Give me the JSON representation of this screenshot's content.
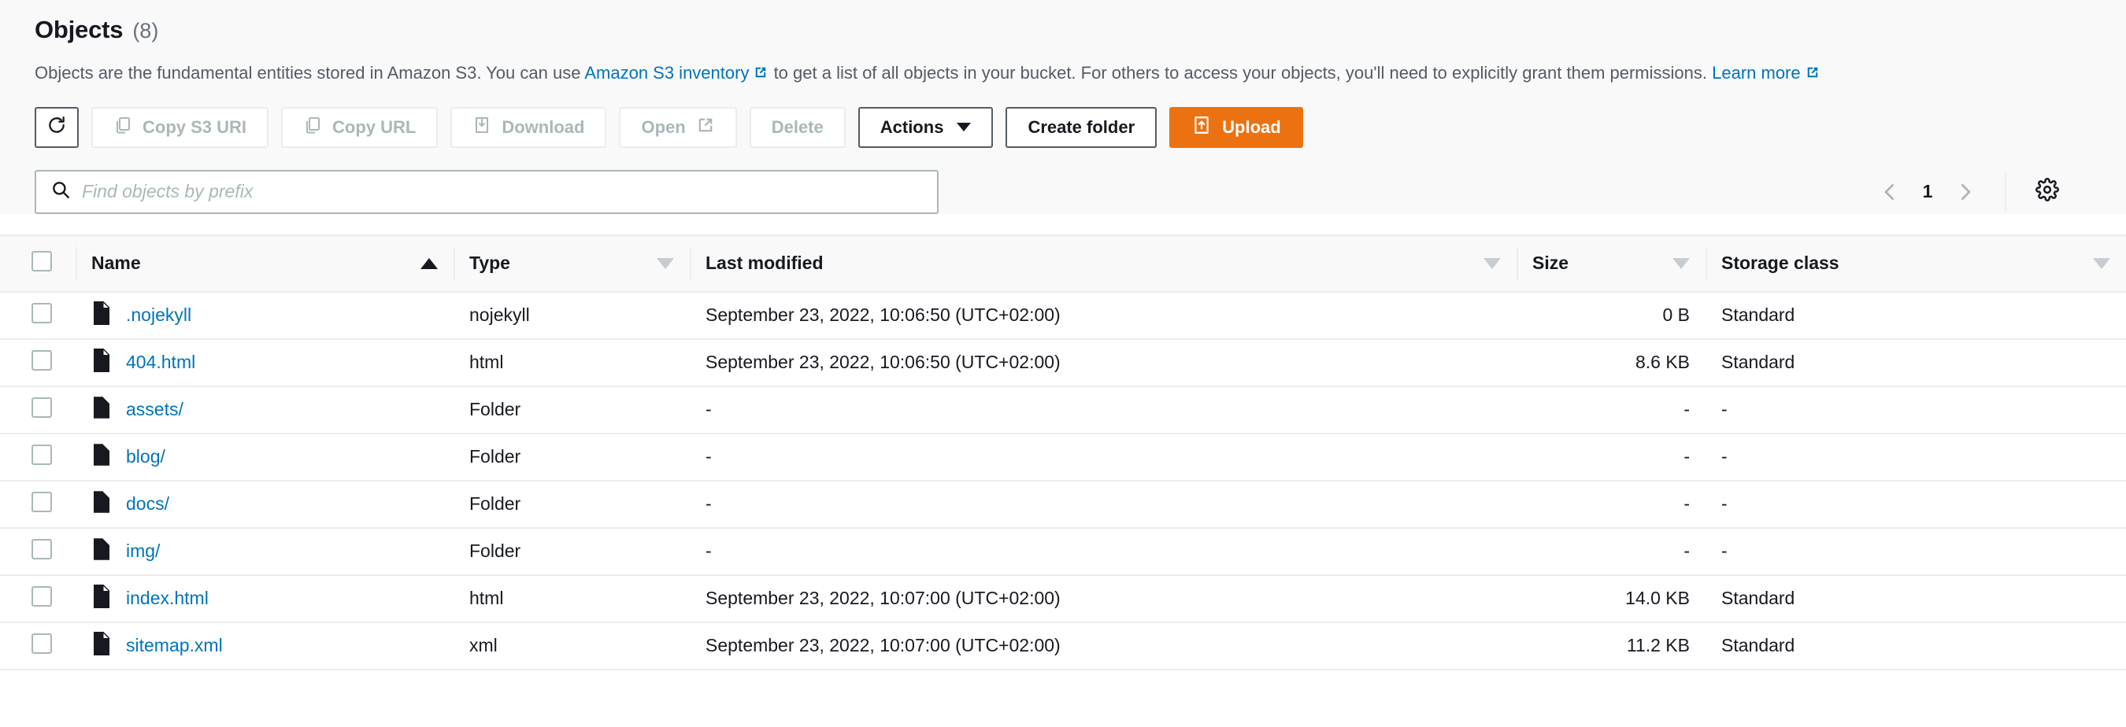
{
  "header": {
    "title": "Objects",
    "count": "(8)",
    "description_part1": "Objects are the fundamental entities stored in Amazon S3. You can use ",
    "inventory_link": "Amazon S3 inventory",
    "description_part2": " to get a list of all objects in your bucket. For others to access your objects, you'll need to explicitly grant them permissions. ",
    "learn_more_link": "Learn more"
  },
  "toolbar": {
    "refresh_label": "",
    "refresh_icon": "refresh-icon",
    "copy_s3_uri_label": "Copy S3 URI",
    "copy_url_label": "Copy URL",
    "download_label": "Download",
    "open_label": "Open",
    "delete_label": "Delete",
    "actions_label": "Actions",
    "create_folder_label": "Create folder",
    "upload_label": "Upload"
  },
  "search": {
    "placeholder": "Find objects by prefix",
    "value": "",
    "icon": "search-icon"
  },
  "pagination": {
    "prev_icon": "chevron-left-icon",
    "page": "1",
    "next_icon": "chevron-right-icon",
    "settings_icon": "gear-icon"
  },
  "table": {
    "columns": [
      {
        "label": "Name",
        "sort": "asc-active"
      },
      {
        "label": "Type",
        "sort": "inactive"
      },
      {
        "label": "Last modified",
        "sort": "inactive"
      },
      {
        "label": "Size",
        "sort": "inactive"
      },
      {
        "label": "Storage class",
        "sort": "inactive"
      }
    ],
    "rows": [
      {
        "icon": "file-icon",
        "name": ".nojekyll",
        "type": "nojekyll",
        "modified": "September 23, 2022, 10:06:50 (UTC+02:00)",
        "size": "0 B",
        "storage_class": "Standard"
      },
      {
        "icon": "file-icon",
        "name": "404.html",
        "type": "html",
        "modified": "September 23, 2022, 10:06:50 (UTC+02:00)",
        "size": "8.6 KB",
        "storage_class": "Standard"
      },
      {
        "icon": "folder-icon",
        "name": "assets/",
        "type": "Folder",
        "modified": "-",
        "size": "-",
        "storage_class": "-"
      },
      {
        "icon": "folder-icon",
        "name": "blog/",
        "type": "Folder",
        "modified": "-",
        "size": "-",
        "storage_class": "-"
      },
      {
        "icon": "folder-icon",
        "name": "docs/",
        "type": "Folder",
        "modified": "-",
        "size": "-",
        "storage_class": "-"
      },
      {
        "icon": "folder-icon",
        "name": "img/",
        "type": "Folder",
        "modified": "-",
        "size": "-",
        "storage_class": "-"
      },
      {
        "icon": "file-icon",
        "name": "index.html",
        "type": "html",
        "modified": "September 23, 2022, 10:07:00 (UTC+02:00)",
        "size": "14.0 KB",
        "storage_class": "Standard"
      },
      {
        "icon": "file-icon",
        "name": "sitemap.xml",
        "type": "xml",
        "modified": "September 23, 2022, 10:07:00 (UTC+02:00)",
        "size": "11.2 KB",
        "storage_class": "Standard"
      }
    ]
  },
  "colors": {
    "link": "#0073bb",
    "primary_button": "#ec7211",
    "text": "#16191f",
    "muted": "#545b64",
    "disabled": "#aab7b8",
    "border": "#eaeded",
    "header_bg": "#f9f9fa"
  }
}
